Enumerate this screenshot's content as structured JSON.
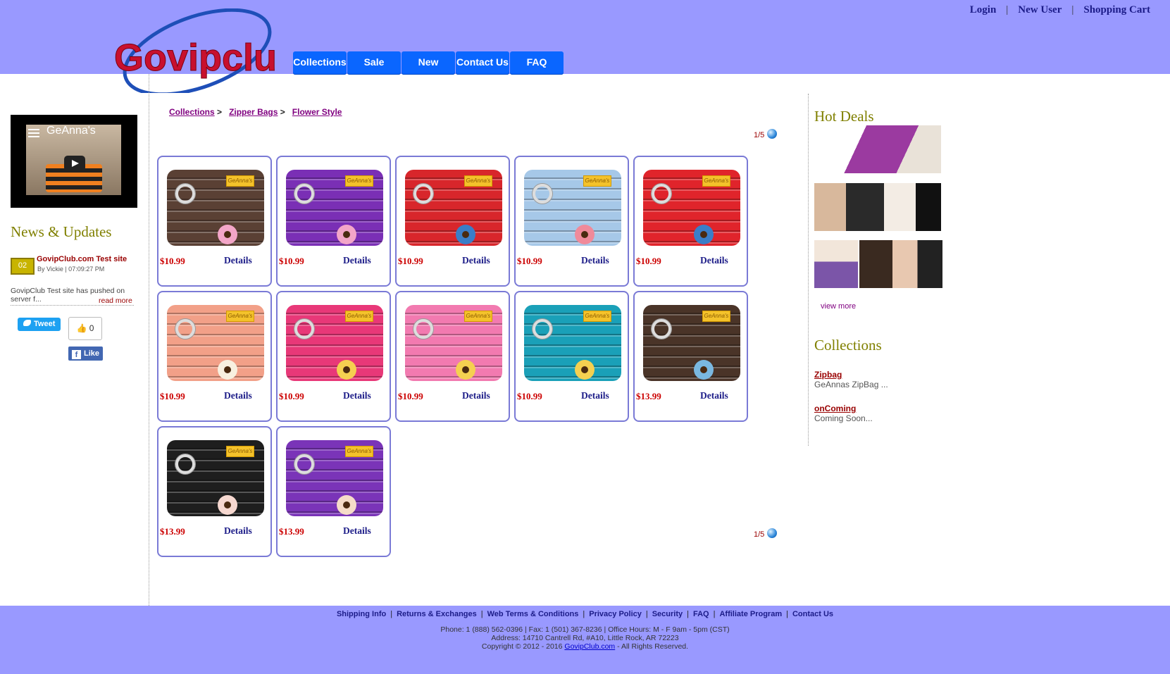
{
  "header": {
    "logo_text": "Govipclub",
    "toplinks": {
      "login": "Login",
      "new_user": "New User",
      "cart": "Shopping Cart",
      "sep": "|"
    },
    "nav": [
      "Collections",
      "Sale",
      "New",
      "Contact Us",
      "FAQ"
    ]
  },
  "left": {
    "video_title": "GeAnna's",
    "news_heading": "News & Updates",
    "news": {
      "day": "02",
      "title": "GovipClub.com Test site",
      "by": "By Vickie | 07:09:27 PM",
      "body": "GovipClub Test site has pushed on server f...",
      "read_more": "read more"
    },
    "tweet": "Tweet",
    "like_count": "0",
    "like": "Like"
  },
  "main": {
    "breadcrumb": [
      "Collections",
      "Zipper Bags",
      "Flower Style"
    ],
    "breadcrumb_sep": ">",
    "pager": "1/5",
    "details_label": "Details",
    "products": [
      {
        "price": "$10.99",
        "color": "#5a4034",
        "flower": "#f3a6c8"
      },
      {
        "price": "$10.99",
        "color": "#7a2fb5",
        "flower": "#f3a6c8"
      },
      {
        "price": "$10.99",
        "color": "#d8262b",
        "flower": "#3a7ec8"
      },
      {
        "price": "$10.99",
        "color": "#a6c8e8",
        "flower": "#f08a9a"
      },
      {
        "price": "$10.99",
        "color": "#e0242b",
        "flower": "#3a7ec8"
      },
      {
        "price": "$10.99",
        "color": "#f2a088",
        "flower": "#f8f0e0"
      },
      {
        "price": "$10.99",
        "color": "#e83878",
        "flower": "#f5d050"
      },
      {
        "price": "$10.99",
        "color": "#f27ab0",
        "flower": "#f5d050"
      },
      {
        "price": "$10.99",
        "color": "#1aa0b8",
        "flower": "#f5d050"
      },
      {
        "price": "$13.99",
        "color": "#4a3428",
        "flower": "#7ab8e0"
      },
      {
        "price": "$13.99",
        "color": "#1e1e1e",
        "flower": "#f6d8d0"
      },
      {
        "price": "$13.99",
        "color": "#7a34b8",
        "flower": "#f5dcc8"
      }
    ],
    "tag_text": "GeAnna's"
  },
  "right": {
    "hot_heading": "Hot Deals",
    "view_more": "view more",
    "collections_heading": "Collections",
    "collections": [
      {
        "name": "Zipbag",
        "desc": "GeAnnas ZipBag ..."
      },
      {
        "name": "onComing",
        "desc": "Coming Soon..."
      }
    ]
  },
  "footer": {
    "links": [
      "Shipping Info",
      "Returns & Exchanges",
      "Web Terms & Conditions",
      "Privacy Policy",
      "Security",
      "FAQ",
      "Affiliate Program",
      "Contact Us"
    ],
    "phone": "Phone: 1 (888) 562-0396 | Fax: 1 (501) 367-8236 | Office Hours: M - F 9am - 5pm (CST)",
    "address": "Address: 14710 Cantrell Rd, #A10, Little Rock, AR 72223",
    "copyright_pre": "Copyright © 2012 - 2016",
    "copyright_link": "GovipClub.com",
    "copyright_post": "- All Rights Reserved."
  }
}
